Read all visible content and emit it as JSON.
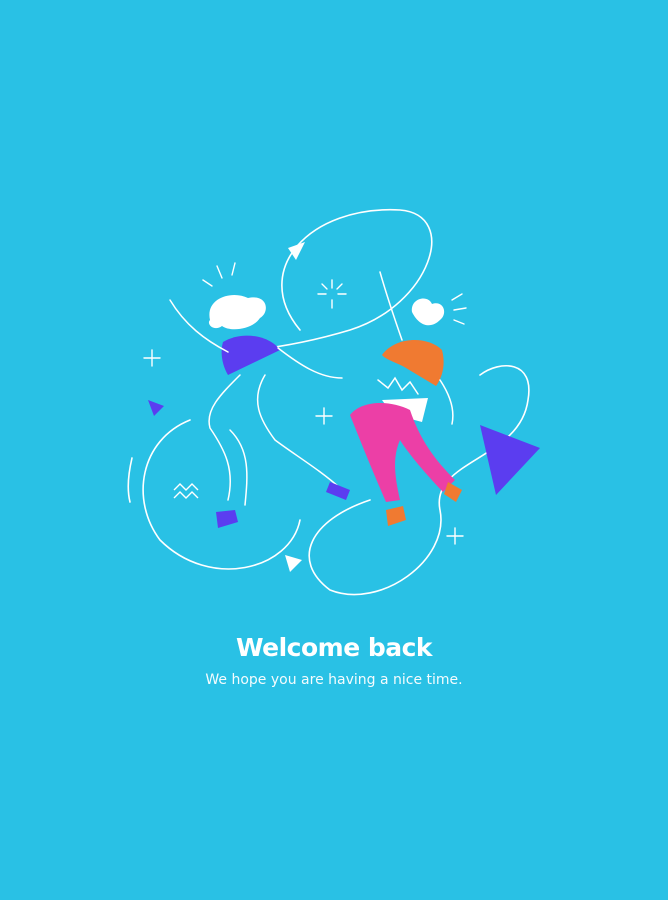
{
  "welcome": {
    "title": "Welcome back",
    "subtitle": "We hope you are having a nice time."
  },
  "illustration": {
    "name": "dancing-people-illustration",
    "icons": [
      "triangle-icon",
      "sparkle-icon",
      "squiggle-icon"
    ]
  },
  "colors": {
    "background": "#29c1e5",
    "purple": "#5b3df0",
    "orange": "#f07a31",
    "pink": "#ec3fa6",
    "white": "#ffffff"
  }
}
